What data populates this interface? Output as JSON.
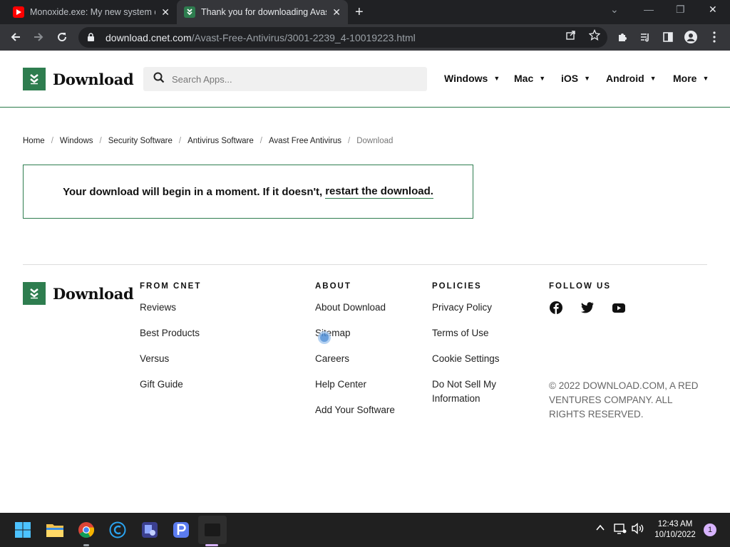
{
  "browser": {
    "tabs": [
      {
        "title": "Monoxide.exe: My new system d",
        "favicon": "youtube-icon",
        "active": false
      },
      {
        "title": "Thank you for downloading Avas",
        "favicon": "download-favicon",
        "active": true
      }
    ],
    "url_host": "download.cnet.com",
    "url_path": "/Avast-Free-Antivirus/3001-2239_4-10019223.html",
    "colors": {
      "tabstrip": "#202124",
      "toolbar": "#35363a"
    }
  },
  "site": {
    "logo_text": "Download",
    "search_placeholder": "Search Apps...",
    "nav": [
      "Windows",
      "Mac",
      "iOS",
      "Android",
      "More"
    ],
    "accent": "#2e7d4f"
  },
  "breadcrumb": [
    "Home",
    "Windows",
    "Security Software",
    "Antivirus Software",
    "Avast Free Antivirus",
    "Download"
  ],
  "notice": {
    "text": "Your download will begin in a moment. If it doesn't,",
    "link": "restart the download."
  },
  "footer": {
    "logo_text": "Download",
    "columns": [
      {
        "heading": "FROM CNET",
        "links": [
          "Reviews",
          "Best Products",
          "Versus",
          "Gift Guide"
        ]
      },
      {
        "heading": "ABOUT",
        "links": [
          "About Download",
          "Sitemap",
          "Careers",
          "Help Center",
          "Add Your Software"
        ]
      },
      {
        "heading": "POLICIES",
        "links": [
          "Privacy Policy",
          "Terms of Use",
          "Cookie Settings",
          "Do Not Sell My Information"
        ]
      }
    ],
    "follow_heading": "FOLLOW US",
    "social": [
      "facebook-icon",
      "twitter-icon",
      "youtube-icon"
    ],
    "copyright": "© 2022 DOWNLOAD.COM, A RED VENTURES COMPANY. ALL RIGHTS RESERVED."
  },
  "taskbar": {
    "time": "12:43 AM",
    "date": "10/10/2022",
    "notifications": "1",
    "apps": [
      "windows-start-icon",
      "file-explorer-icon",
      "chrome-icon",
      "ccleaner-icon",
      "app-icon",
      "p-app-icon",
      "terminal-icon"
    ]
  }
}
